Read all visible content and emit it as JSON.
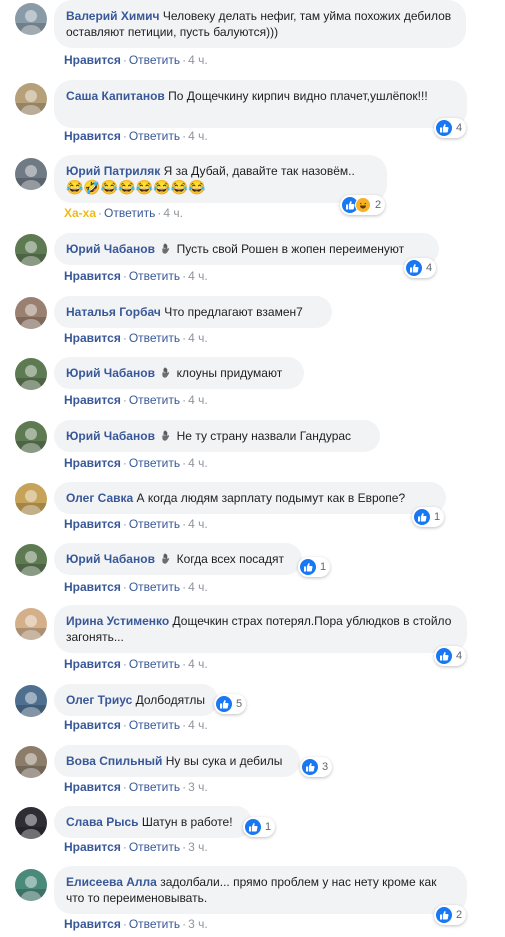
{
  "labels": {
    "like": "Нравится",
    "reply": "Ответить",
    "sep": "·"
  },
  "colors": {
    "link": "#385898",
    "bubble": "#f2f3f5",
    "meta": "#90949c",
    "like_blue": "#1877f2",
    "haha": "#f0ba15"
  },
  "comments": [
    {
      "author": "Валерий Химич",
      "text": "Человеку делать нефиг, там уйма похожих дебилов оставляют петиции, пусть балуются)))",
      "action": "Нравится",
      "time": "4 ч.",
      "reactions": null,
      "avatar_color": "#8a9ba8"
    },
    {
      "author": "Саша Капитанов",
      "text": "По Дощечкину кирпич видно плачет,ушлёпок!!!",
      "action": "Нравится",
      "time": "4 ч.",
      "reactions": {
        "count": "4",
        "types": [
          "like"
        ]
      },
      "avatar_color": "#b6a07a"
    },
    {
      "author": "Юрий Патриляк",
      "text": "Я за Дубай, давайте так назовём..",
      "emojis": "😂🤣😂😂😂😂😂😂",
      "action": "Ха-ха",
      "time": "4 ч.",
      "reactions": {
        "count": "2",
        "types": [
          "like",
          "haha"
        ]
      },
      "avatar_color": "#6f7a84"
    },
    {
      "author": "Юрий Чабанов",
      "badge": "hand-icon",
      "text": "Пусть свой Рошен в жопен переименуют",
      "action": "Нравится",
      "time": "4 ч.",
      "reactions": {
        "count": "4",
        "types": [
          "like"
        ]
      },
      "avatar_color": "#5d7a52"
    },
    {
      "author": "Наталья Горбач",
      "text": "Что предлагают взамен7",
      "action": "Нравится",
      "time": "4 ч.",
      "reactions": null,
      "avatar_color": "#9a8070"
    },
    {
      "author": "Юрий Чабанов",
      "badge": "hand-icon",
      "text": "клоуны придумают",
      "action": "Нравится",
      "time": "4 ч.",
      "reactions": null,
      "avatar_color": "#5d7a52"
    },
    {
      "author": "Юрий Чабанов",
      "badge": "hand-icon",
      "text": "Не ту страну назвали Гандурас",
      "action": "Нравится",
      "time": "4 ч.",
      "reactions": null,
      "avatar_color": "#5d7a52"
    },
    {
      "author": "Олег Савка",
      "text": "А когда людям зарплату подымут как в Европе?",
      "action": "Нравится",
      "time": "4 ч.",
      "reactions": {
        "count": "1",
        "types": [
          "like"
        ]
      },
      "avatar_color": "#c7a35a"
    },
    {
      "author": "Юрий Чабанов",
      "badge": "hand-icon",
      "text": "Когда всех посадят",
      "action": "Нравится",
      "time": "4 ч.",
      "reactions": {
        "count": "1",
        "types": [
          "like"
        ]
      },
      "avatar_color": "#5d7a52"
    },
    {
      "author": "Ирина Устименко",
      "text": "Дощечкин страх потерял.Пора ублюдков в стойло загонять...",
      "action": "Нравится",
      "time": "4 ч.",
      "reactions": {
        "count": "4",
        "types": [
          "like"
        ]
      },
      "avatar_color": "#d3b08a"
    },
    {
      "author": "Олег Триус",
      "text": "Долбодятлы",
      "action": "Нравится",
      "time": "4 ч.",
      "reactions": {
        "count": "5",
        "types": [
          "like"
        ]
      },
      "avatar_color": "#4f6f8f"
    },
    {
      "author": "Вова Спильный",
      "text": "Ну вы сука и дебилы",
      "action": "Нравится",
      "time": "3 ч.",
      "reactions": {
        "count": "3",
        "types": [
          "like"
        ]
      },
      "avatar_color": "#8c7d6a"
    },
    {
      "author": "Слава Рысь",
      "text": "Шатун в работе!",
      "action": "Нравится",
      "time": "3 ч.",
      "reactions": {
        "count": "1",
        "types": [
          "like"
        ]
      },
      "avatar_color": "#2d2d33"
    },
    {
      "author": "Елисеева Алла",
      "text": "задолбали... прямо проблем у нас нету кроме как что то переименовывать.",
      "action": "Нравится",
      "time": "3 ч.",
      "reactions": {
        "count": "2",
        "types": [
          "like"
        ]
      },
      "avatar_color": "#4a8a7a"
    }
  ]
}
